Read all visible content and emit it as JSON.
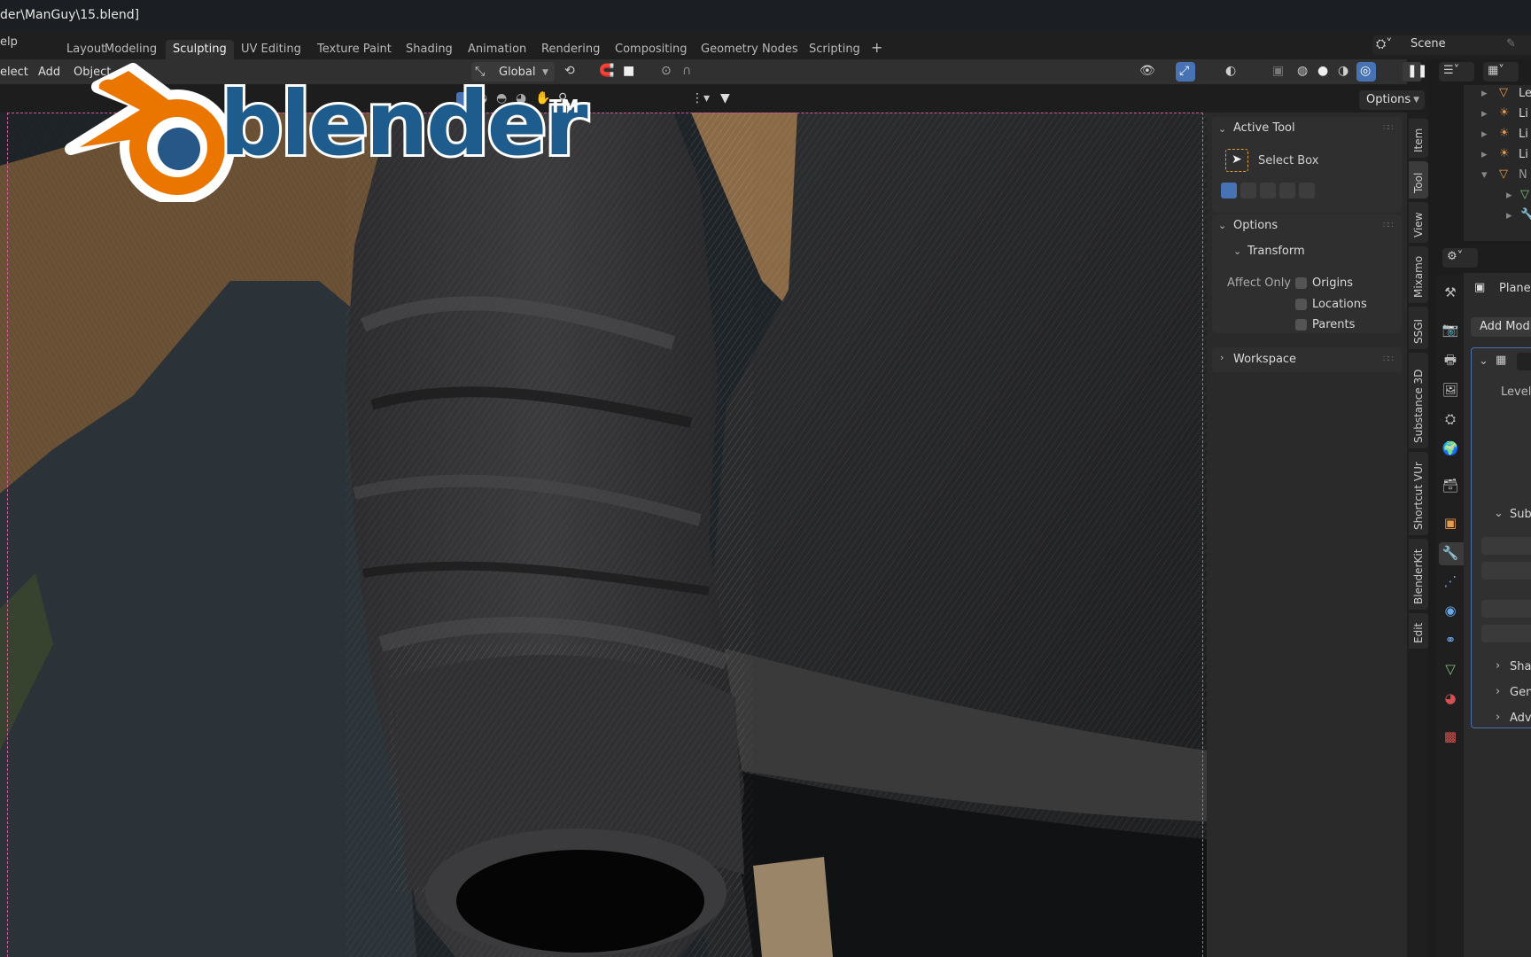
{
  "window": {
    "title": "der\\ManGuy\\15.blend]"
  },
  "menubar": {
    "help": "elp"
  },
  "workspaces": {
    "tabs": [
      "Layout",
      "Modeling",
      "Sculpting",
      "UV Editing",
      "Texture Paint",
      "Shading",
      "Animation",
      "Rendering",
      "Compositing",
      "Geometry Nodes",
      "Scripting"
    ],
    "active": "Sculpting"
  },
  "scene": {
    "label": "Scene"
  },
  "header": {
    "select": "elect",
    "add": "Add",
    "object": "Object",
    "orientation": "Global",
    "options": "Options"
  },
  "logo": {
    "text": "blender",
    "tm": "TM"
  },
  "npanel": {
    "active_tool": {
      "title": "Active Tool",
      "tool_name": "Select Box"
    },
    "options": {
      "title": "Options",
      "transform": "Transform",
      "affect_only": "Affect Only",
      "checkboxes": [
        "Origins",
        "Locations",
        "Parents"
      ]
    },
    "workspace": {
      "title": "Workspace"
    }
  },
  "vertical_tabs": [
    "Item",
    "Tool",
    "View",
    "Mixamo",
    "SSGI",
    "Substance 3D",
    "Shortcut VUr",
    "BlenderKit",
    "Edit"
  ],
  "outliner": {
    "items": [
      "Le",
      "Li",
      "Li",
      "Li",
      "N"
    ]
  },
  "properties": {
    "object_name": "Plane.",
    "add_modifier": "Add Modi",
    "modifier_field": "Level",
    "subsection": "Subc",
    "collapsed": [
      "Shap",
      "Gen",
      "Adva"
    ]
  },
  "colors": {
    "accent": "#4772b3",
    "logo_orange": "#ea7600",
    "logo_blue": "#265787",
    "frame": "#d05a9a"
  }
}
